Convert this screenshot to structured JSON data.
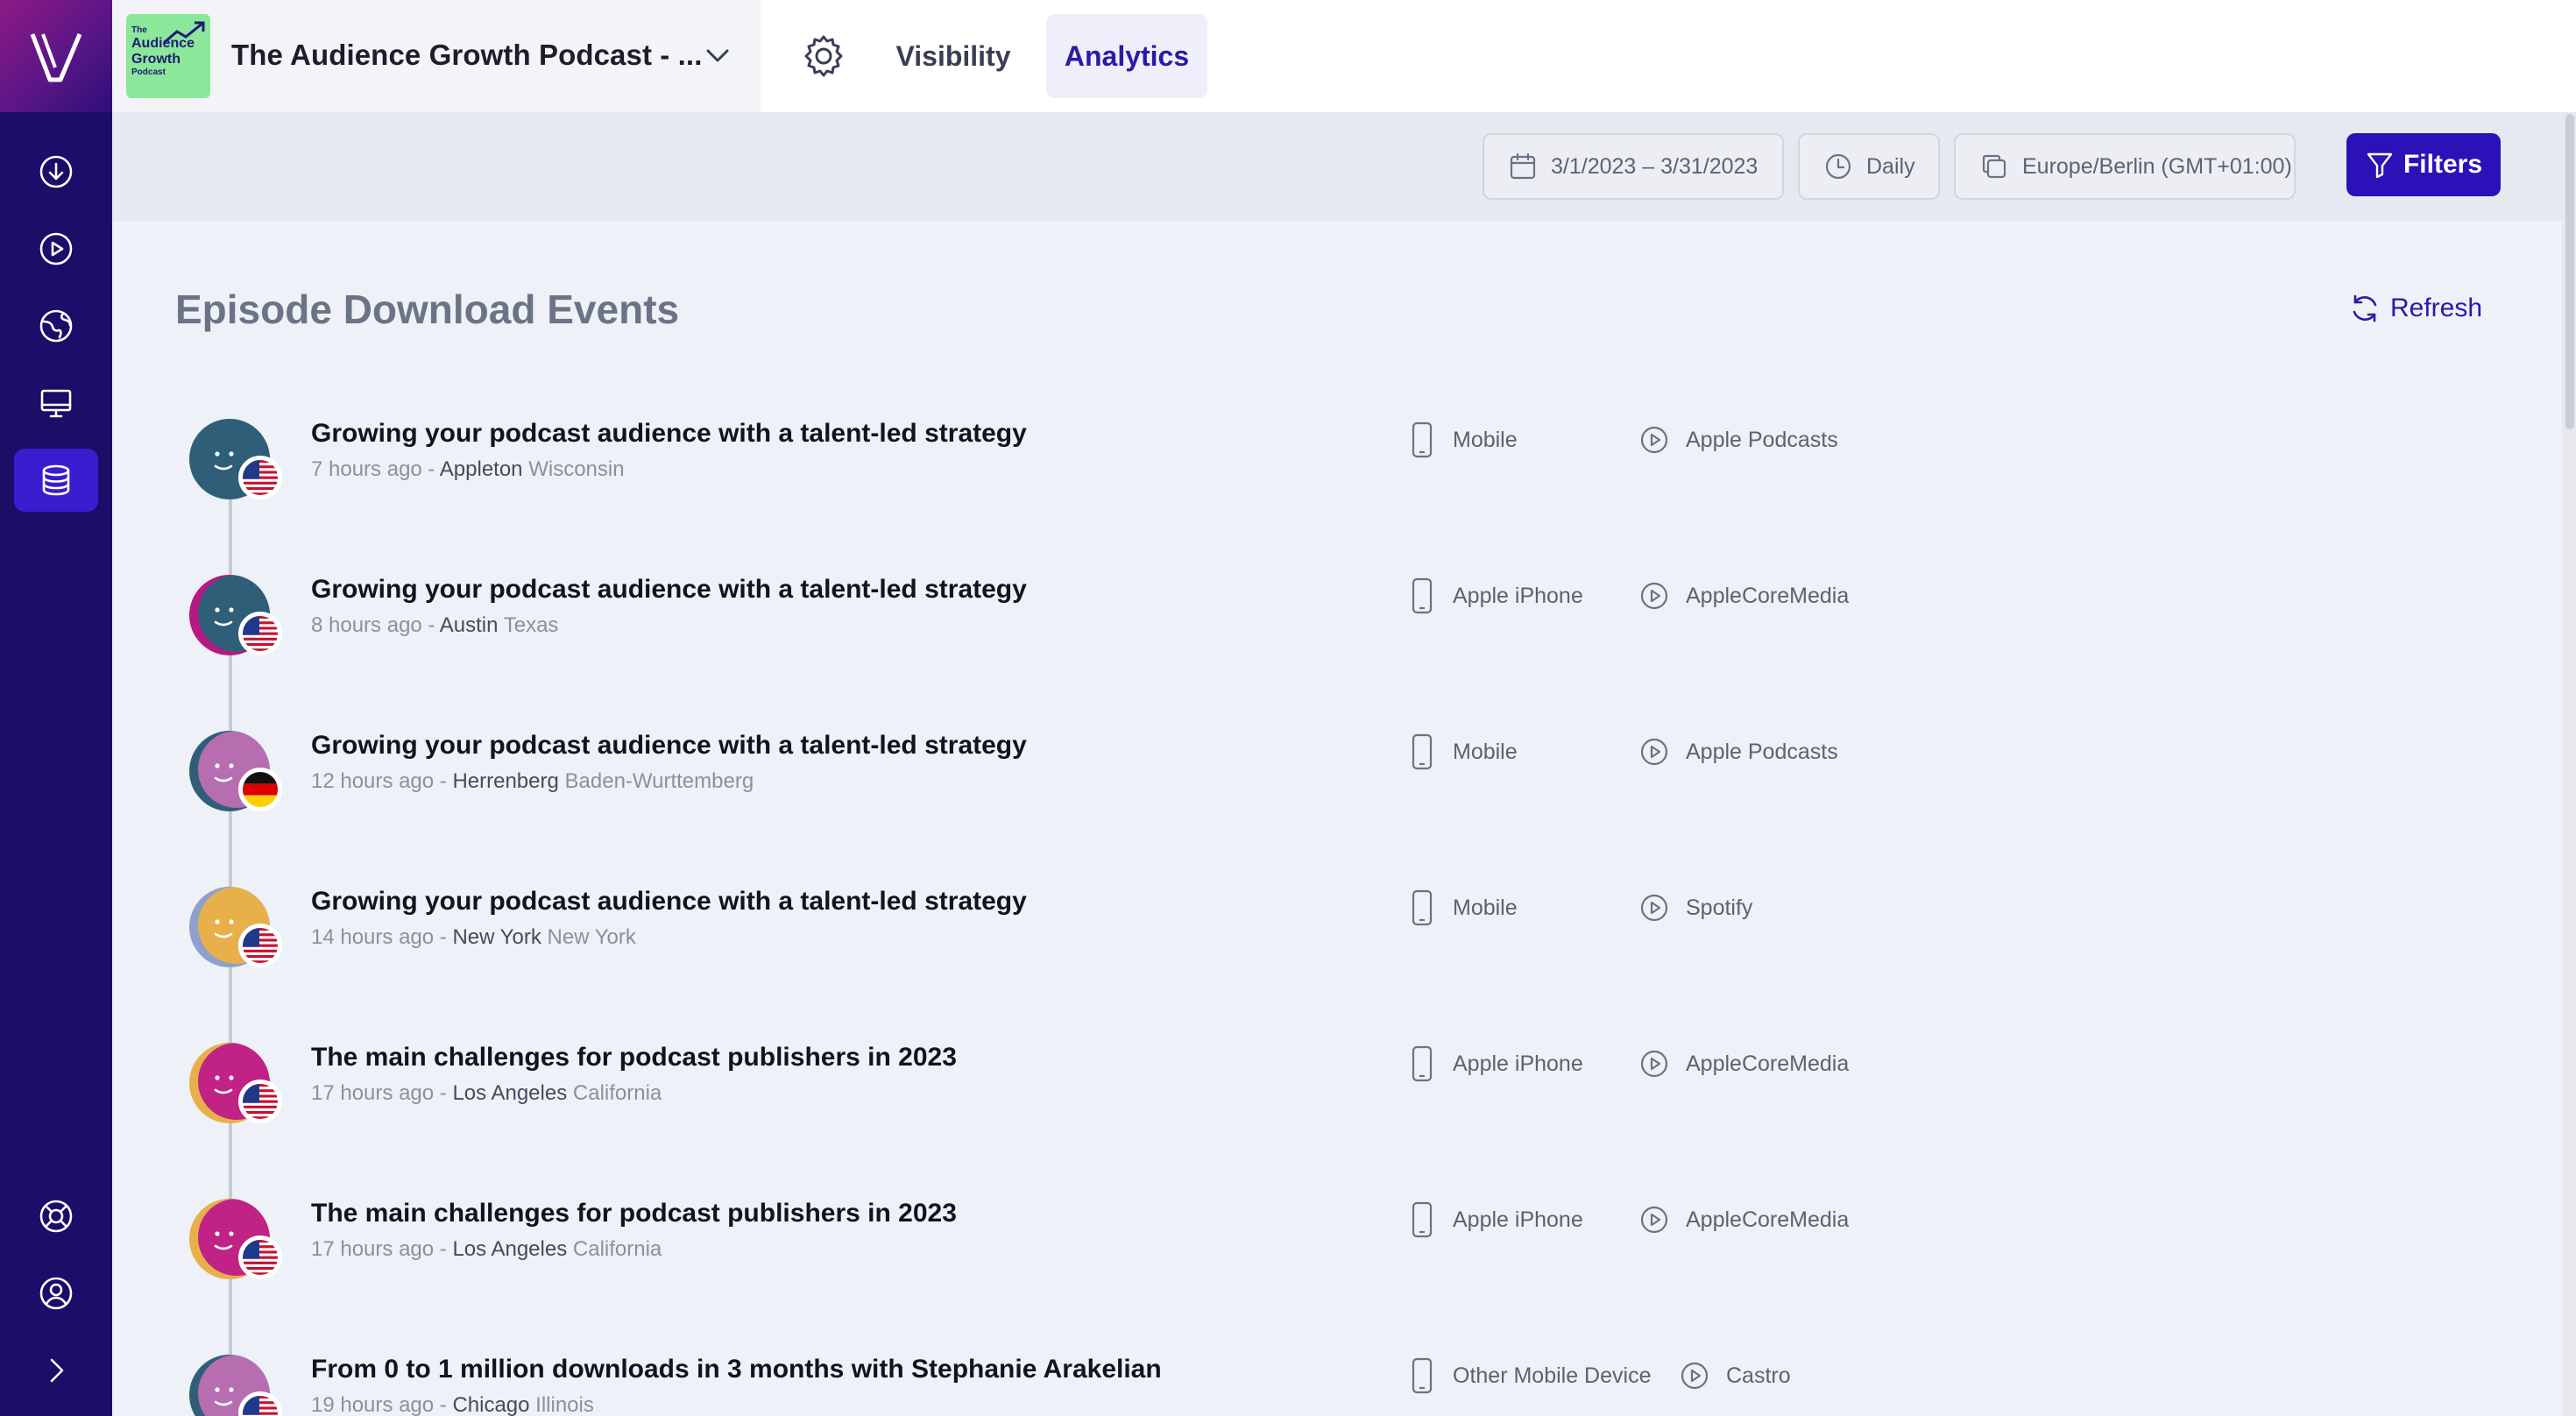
{
  "header": {
    "podcast_title": "The Audience Growth Podcast - ...",
    "cover_text": [
      "The",
      "Audience",
      "Growth",
      "Podcast"
    ],
    "tabs": [
      {
        "label": "Visibility",
        "active": false
      },
      {
        "label": "Analytics",
        "active": true
      }
    ]
  },
  "toolbar": {
    "date_range": "3/1/2023 – 3/31/2023",
    "interval": "Daily",
    "timezone": "Europe/Berlin (GMT+01:00)",
    "filters_label": "Filters"
  },
  "sidebar": {
    "items": [
      {
        "icon": "download-icon",
        "active": false
      },
      {
        "icon": "play-circle-icon",
        "active": false
      },
      {
        "icon": "globe-icon",
        "active": false
      },
      {
        "icon": "monitor-icon",
        "active": false
      },
      {
        "icon": "database-icon",
        "active": true
      }
    ],
    "bottom": [
      "lifebuoy-icon",
      "user-circle-icon",
      "chevron-right-icon"
    ]
  },
  "main": {
    "heading": "Episode Download Events",
    "refresh_label": "Refresh",
    "events": [
      {
        "title": "Growing your podcast audience with a talent-led strategy",
        "time": "7 hours ago",
        "city": "Appleton",
        "region": "Wisconsin",
        "device": "Mobile",
        "platform": "Apple Podcasts",
        "country": "us",
        "avatar_color": "#2f5f78",
        "avatar_alt": "#2f5f78"
      },
      {
        "title": "Growing your podcast audience with a talent-led strategy",
        "time": "8 hours ago",
        "city": "Austin",
        "region": "Texas",
        "device": "Apple iPhone",
        "platform": "AppleCoreMedia",
        "country": "us",
        "avatar_color": "#2f5f78",
        "avatar_alt": "#b6197f"
      },
      {
        "title": "Growing your podcast audience with a talent-led strategy",
        "time": "12 hours ago",
        "city": "Herrenberg",
        "region": "Baden-Wurttemberg",
        "device": "Mobile",
        "platform": "Apple Podcasts",
        "country": "de",
        "avatar_color": "#b66eb0",
        "avatar_alt": "#2f5f78"
      },
      {
        "title": "Growing your podcast audience with a talent-led strategy",
        "time": "14 hours ago",
        "city": "New York",
        "region": "New York",
        "device": "Mobile",
        "platform": "Spotify",
        "country": "us",
        "avatar_color": "#e8b04a",
        "avatar_alt": "#8fa0cc"
      },
      {
        "title": "The main challenges for podcast publishers in 2023",
        "time": "17 hours ago",
        "city": "Los Angeles",
        "region": "California",
        "device": "Apple iPhone",
        "platform": "AppleCoreMedia",
        "country": "us",
        "avatar_color": "#c02385",
        "avatar_alt": "#e8b04a"
      },
      {
        "title": "The main challenges for podcast publishers in 2023",
        "time": "17 hours ago",
        "city": "Los Angeles",
        "region": "California",
        "device": "Apple iPhone",
        "platform": "AppleCoreMedia",
        "country": "us",
        "avatar_color": "#c02385",
        "avatar_alt": "#e8b04a"
      },
      {
        "title": "From 0 to 1 million downloads in 3 months with Stephanie Arakelian",
        "time": "19 hours ago",
        "city": "Chicago",
        "region": "Illinois",
        "device": "Other Mobile Device",
        "platform": "Castro",
        "country": "us",
        "avatar_color": "#b66eb0",
        "avatar_alt": "#2f5f78"
      }
    ]
  }
}
